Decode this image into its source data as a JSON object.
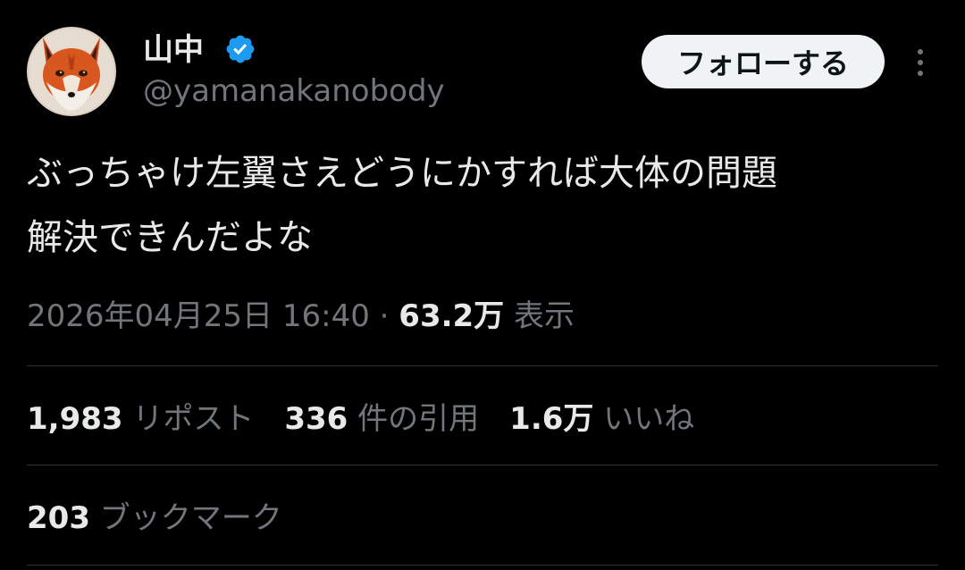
{
  "author": {
    "display_name": "山中",
    "handle": "@yamanakanobody",
    "avatar_icon": "fox-avatar",
    "verified_icon": "verified-badge-icon",
    "verified_color": "#1d9bf0"
  },
  "header": {
    "follow_label": "フォローする",
    "more_icon": "more-options-icon"
  },
  "tweet": {
    "text_lines": [
      "ぶっちゃけ左翼さえどうにかすれば大体の問題",
      "解決できんだよな"
    ]
  },
  "meta": {
    "timestamp": "2026年04月25日 16:40",
    "separator": "·",
    "views_count": "63.2万",
    "views_label": "表示"
  },
  "stats": {
    "reposts_count": "1,983",
    "reposts_label": "リポスト",
    "quotes_count": "336",
    "quotes_label": "件の引用",
    "likes_count": "1.6万",
    "likes_label": "いいね",
    "bookmarks_count": "203",
    "bookmarks_label": "ブックマーク"
  },
  "colors": {
    "background": "#000000",
    "text_primary": "#e7e9ea",
    "text_secondary": "#71767b",
    "divider": "#2f3336",
    "follow_button_bg": "#eff3f4"
  }
}
